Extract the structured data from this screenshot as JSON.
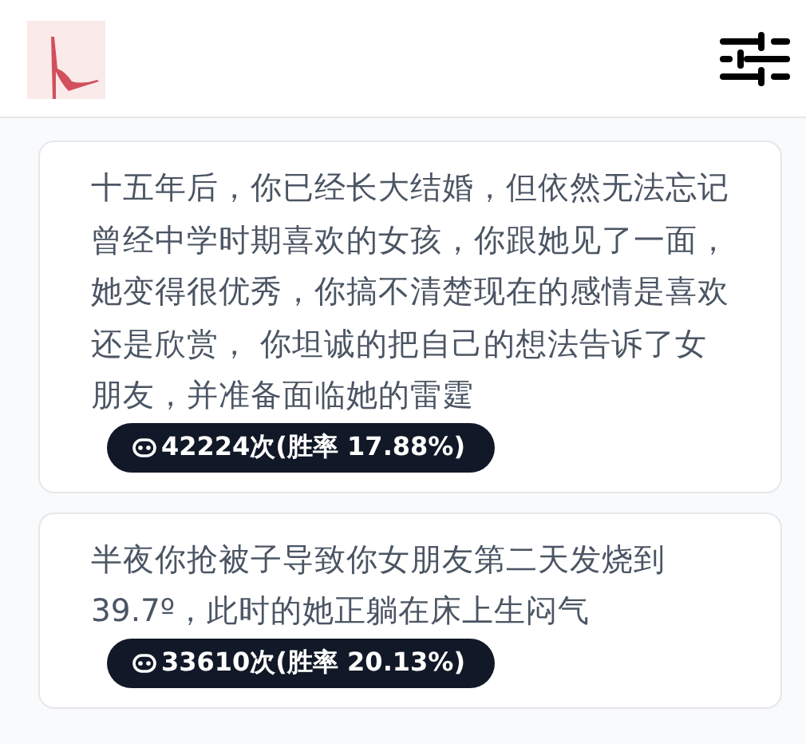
{
  "cards": [
    {
      "text": "十五年后，你已经长大结婚，但依然无法忘记曾经中学时期喜欢的女孩，你跟她见了一面，她变得很优秀，你搞不清楚现在的感情是喜欢还是欣赏， 你坦诚的把自己的想法告诉了女朋友，并准备面临她的雷霆",
      "stat": "42224次(胜率 17.88%)"
    },
    {
      "text": "半夜你抢被子导致你女朋友第二天发烧到39.7º，此时的她正躺在床上生闷气",
      "stat": "33610次(胜率 20.13%)"
    }
  ]
}
